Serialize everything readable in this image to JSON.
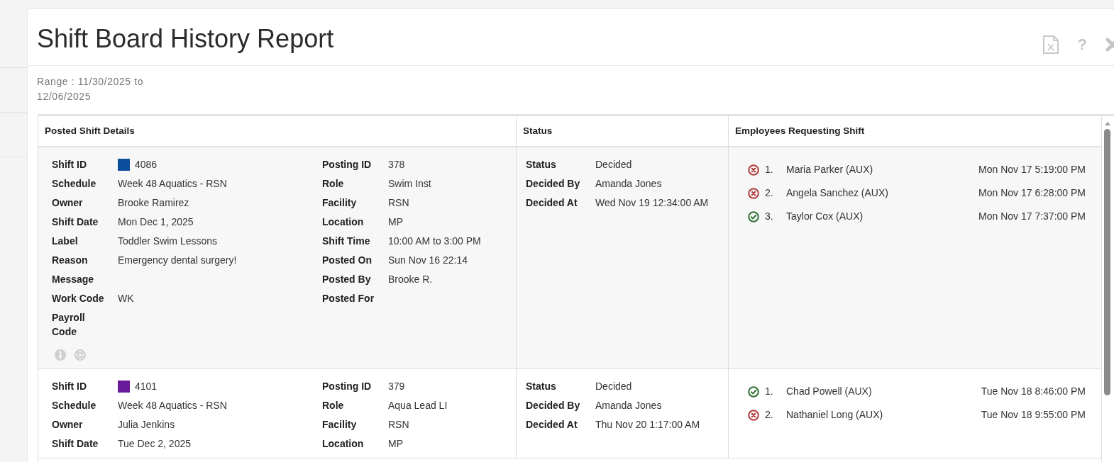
{
  "title": "Shift Board History Report",
  "toolbar": [
    {
      "kind": "export"
    },
    {
      "kind": "help",
      "glyph": "?"
    },
    {
      "kind": "close"
    }
  ],
  "range": "Range : 11/30/2025 to 12/06/2025",
  "columns": [
    "Posted Shift Details",
    "Status",
    "Employees Requesting Shift"
  ],
  "shifts": [
    {
      "color": "#0b4f9c",
      "show_icons": true,
      "details_left": [
        {
          "label": "Shift ID",
          "value": "4086"
        },
        {
          "label": "Schedule",
          "value": "Week 48 Aquatics - RSN"
        },
        {
          "label": "Owner",
          "value": "Brooke Ramirez"
        },
        {
          "label": "Shift Date",
          "value": "Mon Dec 1, 2025"
        },
        {
          "label": "Label",
          "value": "Toddler Swim Lessons"
        },
        {
          "label": "Reason",
          "value": "Emergency dental surgery!"
        },
        {
          "label": "Message"
        },
        {
          "label": "Work Code",
          "value": "WK"
        },
        {
          "label": "Payroll Code"
        }
      ],
      "details_right": [
        {
          "label": "Posting ID",
          "value": "378"
        },
        {
          "label": "Role",
          "value": "Swim Inst"
        },
        {
          "label": "Facility",
          "value": "RSN"
        },
        {
          "label": "Location",
          "value": "MP"
        },
        {
          "label": "Shift Time",
          "value": "10:00 AM to 3:00 PM"
        },
        {
          "label": "Posted On",
          "value": "Sun Nov 16 22:14"
        },
        {
          "label": "Posted By",
          "value": "Brooke R."
        },
        {
          "label": "Posted For"
        }
      ],
      "status": [
        {
          "label": "Status",
          "value": "Decided"
        },
        {
          "label": "Decided By",
          "value": "Amanda Jones"
        },
        {
          "label": "Decided At",
          "value": "Wed Nov 19 12:34:00 AM"
        }
      ],
      "requests": [
        {
          "approved": false,
          "number": "1.",
          "name": "Maria Parker (AUX)",
          "time": "Mon Nov 17 5:19:00 PM"
        },
        {
          "approved": false,
          "number": "2.",
          "name": "Angela Sanchez (AUX)",
          "time": "Mon Nov 17 6:28:00 PM"
        },
        {
          "approved": true,
          "number": "3.",
          "name": "Taylor Cox (AUX)",
          "time": "Mon Nov 17 7:37:00 PM"
        }
      ]
    },
    {
      "color": "#6a1b9a",
      "details_left": [
        {
          "label": "Shift ID",
          "value": "4101"
        },
        {
          "label": "Schedule",
          "value": "Week 48 Aquatics - RSN"
        },
        {
          "label": "Owner",
          "value": "Julia Jenkins"
        },
        {
          "label": "Shift Date",
          "value": "Tue Dec 2, 2025"
        }
      ],
      "details_right": [
        {
          "label": "Posting ID",
          "value": "379"
        },
        {
          "label": "Role",
          "value": "Aqua Lead LI"
        },
        {
          "label": "Facility",
          "value": "RSN"
        },
        {
          "label": "Location",
          "value": "MP"
        }
      ],
      "status": [
        {
          "label": "Status",
          "value": "Decided"
        },
        {
          "label": "Decided By",
          "value": "Amanda Jones"
        },
        {
          "label": "Decided At",
          "value": "Thu Nov 20 1:17:00 AM"
        }
      ],
      "requests": [
        {
          "approved": true,
          "number": "1.",
          "name": "Chad Powell (AUX)",
          "time": "Tue Nov 18 8:46:00 PM"
        },
        {
          "approved": false,
          "number": "2.",
          "name": "Nathaniel Long (AUX)",
          "time": "Tue Nov 18 9:55:00 PM"
        }
      ]
    }
  ]
}
